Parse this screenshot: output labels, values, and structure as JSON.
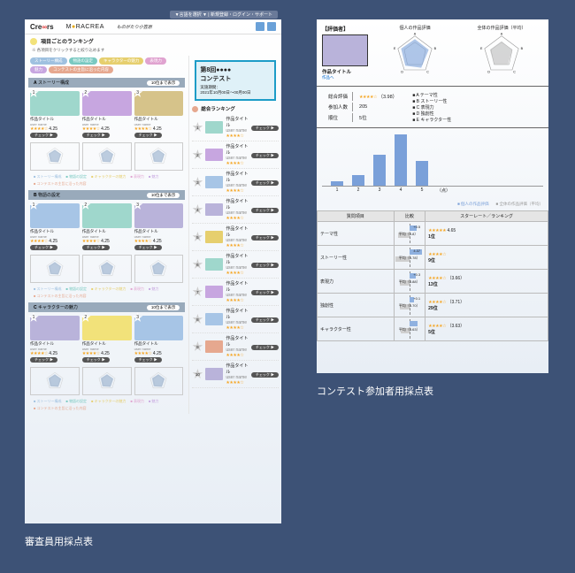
{
  "captions": {
    "judge": "審査員用採点表",
    "participant": "コンテスト参加者用採点表"
  },
  "header": {
    "toplink": "▼言語を選択 ▼ | 新規登録・ログイン・サポート",
    "logo1_a": "Cre",
    "logo1_b": "∞",
    "logo1_c": "rs",
    "logo2_a": "M",
    "logo2_b": "●",
    "logo2_c": "RACREA",
    "script": "ものがたり小笠原"
  },
  "ranking": {
    "title": "項目ごとのランキング",
    "sub": "※ 各項目をクリックすると絞り込めます",
    "tags": [
      {
        "label": "ストーリー構成",
        "color": "#9fc1e0"
      },
      {
        "label": "物語の設定",
        "color": "#79c9c1"
      },
      {
        "label": "キャラクターの魅力",
        "color": "#e6cf6e"
      },
      {
        "label": "表現力",
        "color": "#e0a3d0"
      },
      {
        "label": "魅力",
        "color": "#c7a6e0"
      },
      {
        "label": "コンテストの主旨に沿った内容",
        "color": "#e6a88f"
      }
    ],
    "bands": {
      "more": "10位まで表示"
    },
    "sections": [
      {
        "letter": "A",
        "title": "ストーリー構成",
        "colors": [
          "#9fd7cc",
          "#c7a6e0",
          "#d6c38a"
        ]
      },
      {
        "letter": "B",
        "title": "物語の設定",
        "colors": [
          "#a7c5e6",
          "#9fd7cc",
          "#b9b3da"
        ]
      },
      {
        "letter": "C",
        "title": "キャラクターの魅力",
        "colors": [
          "#b9b3da",
          "#f2e27a",
          "#a7c5e6"
        ]
      }
    ],
    "card": {
      "title": "作品タイトル",
      "user": "user name",
      "score": "4.25",
      "check": "チェック ▶"
    }
  },
  "contest": {
    "title_a": "第8回●●●●",
    "title_b": "コンテスト",
    "period_label": "実施期間：",
    "period": "2021年10月00日〜00月00日"
  },
  "overall": {
    "title": "総合ランキング",
    "items_colors": [
      "#9fd7cc",
      "#c7a6e0",
      "#a7c5e6",
      "#b9b3da",
      "#e6cf6e",
      "#9fd7cc",
      "#c7a6e0",
      "#a7c5e6",
      "#e6a88f",
      "#b9b3da"
    ]
  },
  "participant": {
    "head": "【評価者】",
    "work_title": "作品タイトル",
    "work_link": "作品へ",
    "radar1": "個人の作品評価",
    "radar2": "全体の作品評価（平均）",
    "axis": [
      "A",
      "B",
      "C",
      "D",
      "E"
    ],
    "info": {
      "r1a": "総合評価",
      "r1b": "★★★★☆",
      "r1c": "（3.98）",
      "r2a": "参加人数",
      "r2b": "205",
      "r3a": "順位",
      "r3b": "5位"
    },
    "criteria": [
      "テーマ性",
      "ストーリー性",
      "表現力",
      "独創性",
      "キャラクター性"
    ],
    "legend_own": "個人の作品評価",
    "legend_avg": "全体の作品評価（平均）",
    "table_headers": [
      "質問項目",
      "比較",
      "スターレート／ランキング"
    ],
    "rows": [
      {
        "label": "テーマ性",
        "diff": "+0.5",
        "own_w": 30,
        "avg": "平均（4.8）",
        "avg_w": 45,
        "stars": "★★★★★",
        "score": "4.65",
        "rank": "1位"
      },
      {
        "label": "ストーリー性",
        "diff": "4.37",
        "own_w": 50,
        "avg": "平均（4.78）",
        "avg_w": 58,
        "stars": "★★★★☆",
        "score": "",
        "rank": "9位"
      },
      {
        "label": "表現力",
        "diff": "+0.3",
        "own_w": 25,
        "avg": "平均（3.88）",
        "avg_w": 40,
        "stars": "★★★★☆",
        "score": "（3.66）",
        "rank": "13位"
      },
      {
        "label": "独創性",
        "diff": "+0.1",
        "own_w": 18,
        "avg": "平均（3.70）",
        "avg_w": 38,
        "stars": "★★★★☆",
        "score": "（3.71）",
        "rank": "29位"
      },
      {
        "label": "キャラクター性",
        "diff": "",
        "own_w": 32,
        "avg": "平均（3.63）",
        "avg_w": 36,
        "stars": "★★★★☆",
        "score": "（3.63）",
        "rank": "5位"
      }
    ]
  },
  "chart_data": {
    "type": "bar",
    "title": "",
    "categories": [
      "1",
      "2",
      "3",
      "4",
      "5",
      "（点）"
    ],
    "values": [
      5,
      12,
      35,
      58,
      28,
      0
    ],
    "ylim": [
      0,
      60
    ]
  }
}
